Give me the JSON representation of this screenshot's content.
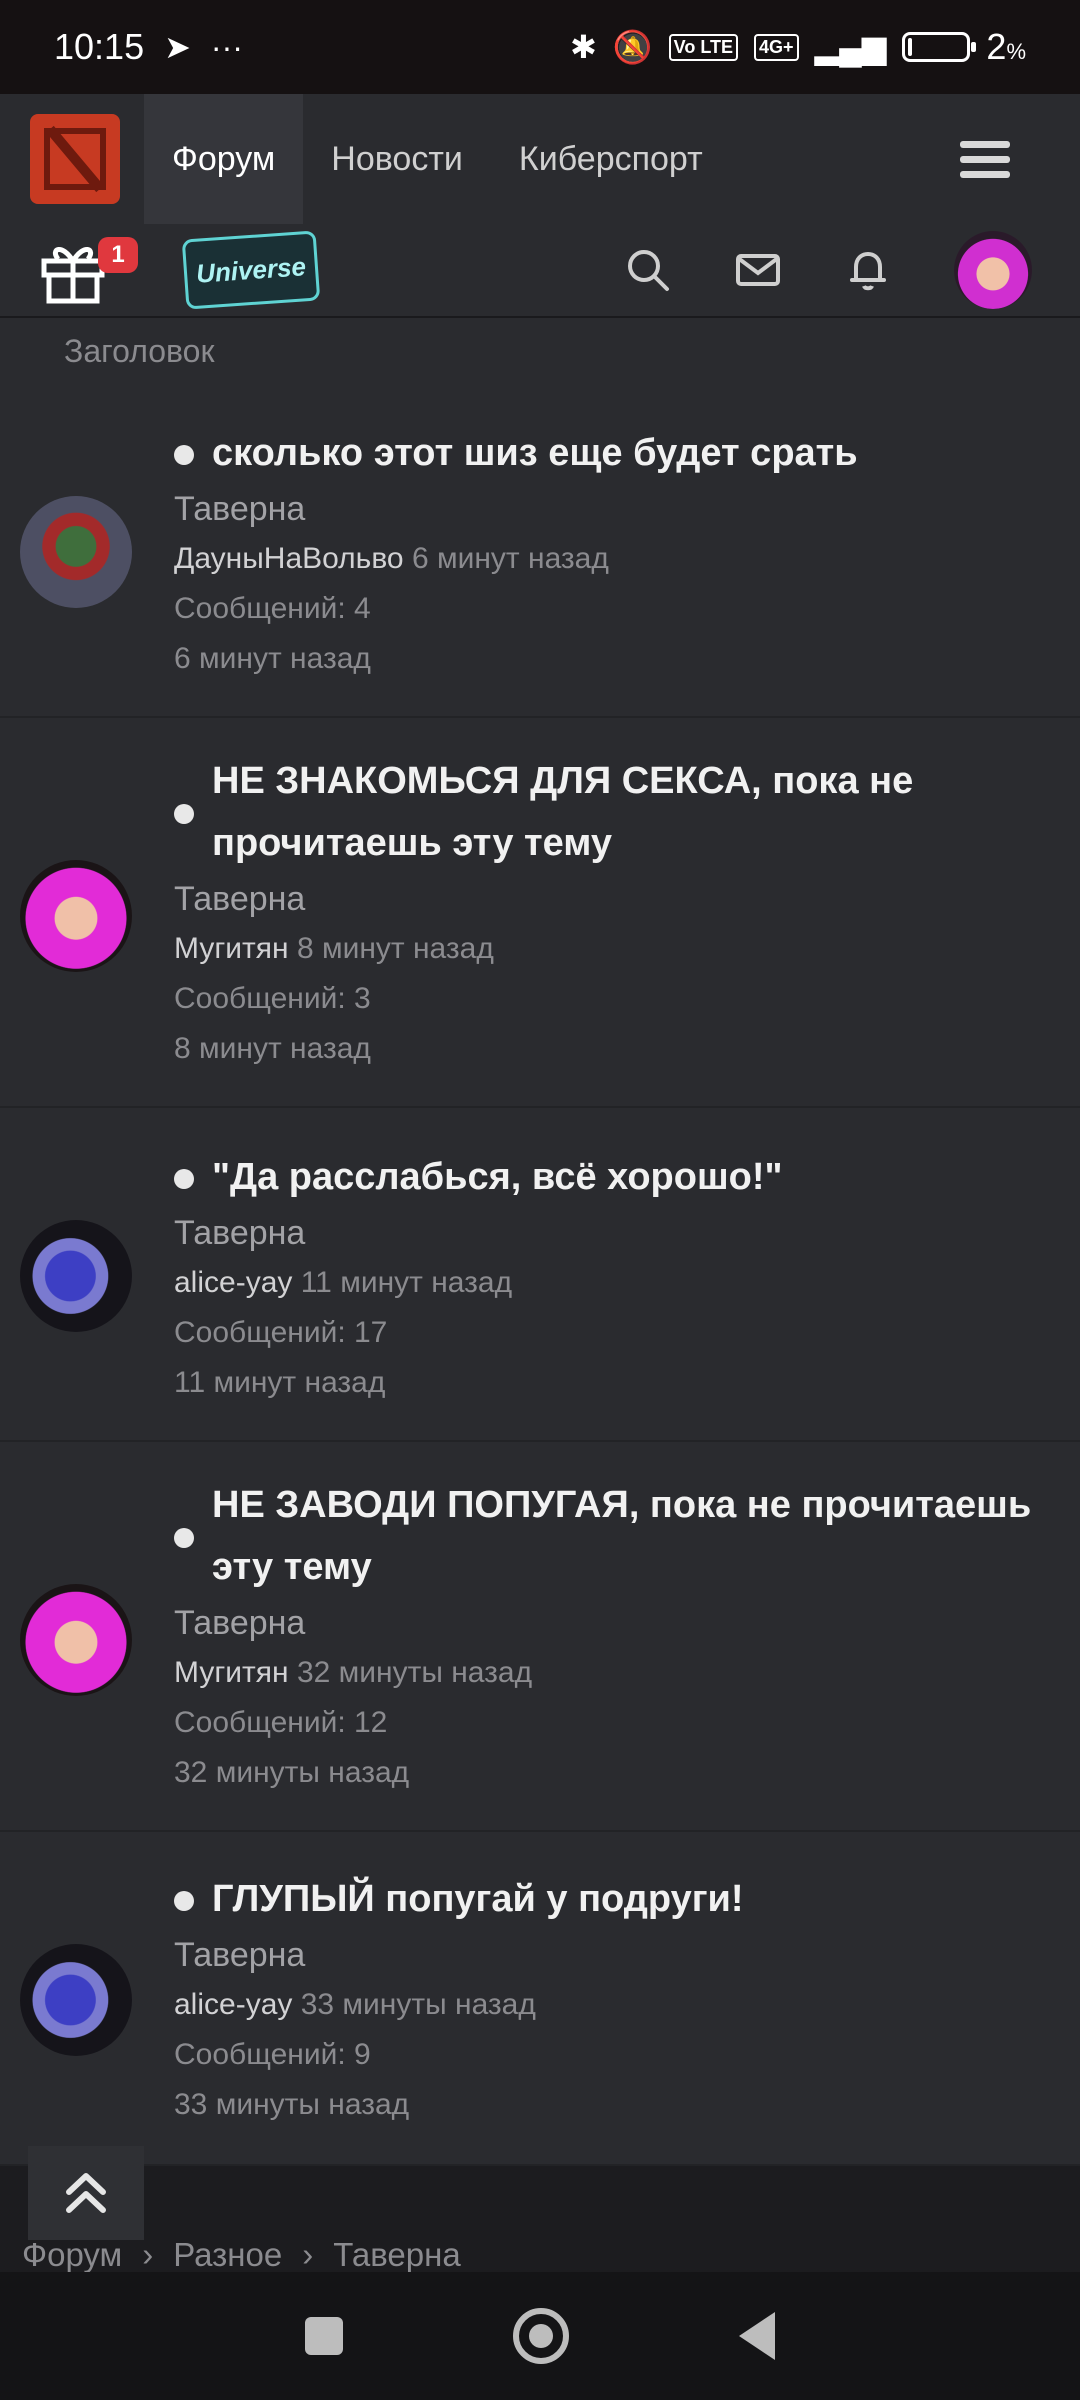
{
  "status_bar": {
    "time": "10:15",
    "battery_percent": "2",
    "battery_unit": "%",
    "network": "4G+",
    "volte": "Vo LTE"
  },
  "nav": {
    "tabs": [
      {
        "label": "Форум"
      },
      {
        "label": "Новости"
      },
      {
        "label": "Киберспорт"
      }
    ]
  },
  "toolbar": {
    "gift_badge": "1",
    "universe_label": "Universe"
  },
  "list_header": "Заголовок",
  "threads": [
    {
      "title": "сколько этот шиз еще будет срать",
      "forum": "Таверна",
      "user": "ДауныНаВольво",
      "time": "6 минут назад",
      "messages": "Сообщений: 4",
      "last": "6 минут назад"
    },
    {
      "title": "НЕ ЗНАКОМЬСЯ ДЛЯ СЕКСА, пока не прочитаешь эту тему",
      "forum": "Таверна",
      "user": "Мугитян",
      "time": "8 минут назад",
      "messages": "Сообщений: 3",
      "last": "8 минут назад"
    },
    {
      "title": "\"Да расслабься, всё хорошо!\"",
      "forum": "Таверна",
      "user": "alice-yay",
      "time": "11 минут назад",
      "messages": "Сообщений: 17",
      "last": "11 минут назад"
    },
    {
      "title": "НЕ ЗАВОДИ ПОПУГАЯ, пока не прочитаешь эту тему",
      "forum": "Таверна",
      "user": "Мугитян",
      "time": "32 минуты назад",
      "messages": "Сообщений: 12",
      "last": "32 минуты назад"
    },
    {
      "title": "ГЛУПЫЙ попугай у подруги!",
      "forum": "Таверна",
      "user": "alice-yay",
      "time": "33 минуты назад",
      "messages": "Сообщений: 9",
      "last": "33 минуты назад"
    }
  ],
  "breadcrumb": [
    "Форум",
    "Разное",
    "Таверна"
  ]
}
